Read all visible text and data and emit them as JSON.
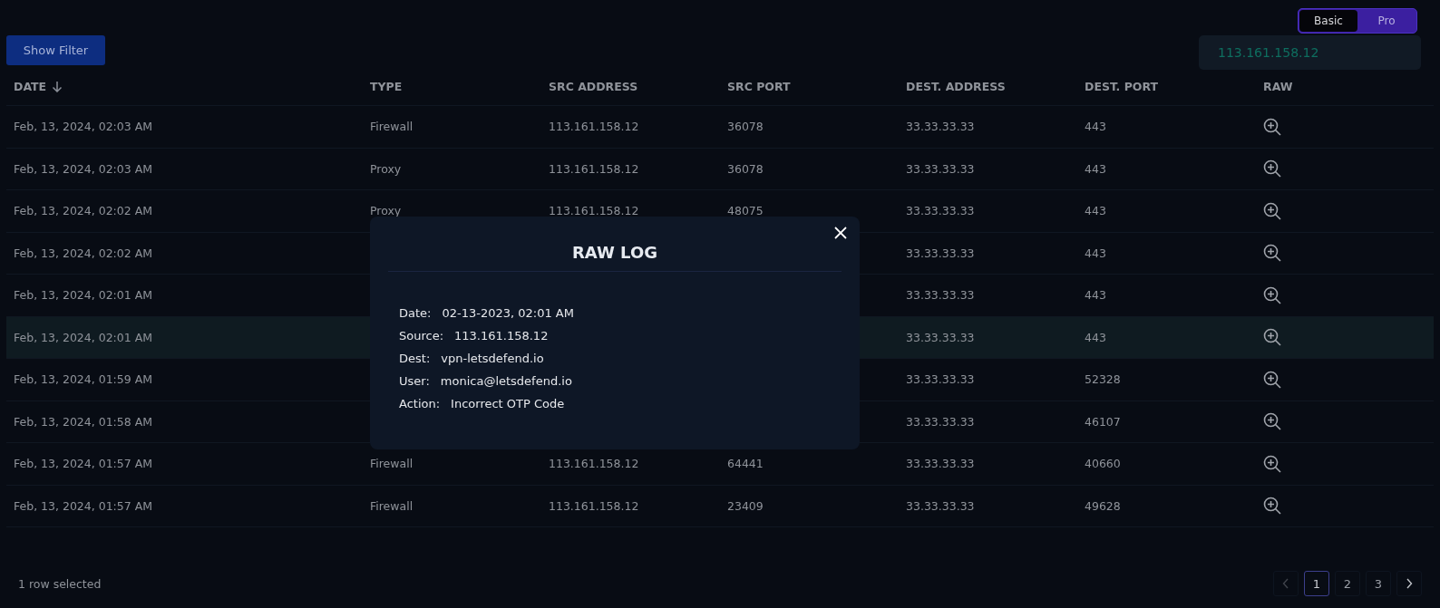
{
  "view_toggle": [
    {
      "label": "Basic",
      "selected": true
    },
    {
      "label": "Pro",
      "selected": false
    }
  ],
  "filter_button": "Show Filter",
  "search": {
    "value": "113.161.158.12"
  },
  "table": {
    "columns": [
      {
        "label": "DATE",
        "sorted_descending": true
      },
      {
        "label": "TYPE"
      },
      {
        "label": "SRC ADDRESS"
      },
      {
        "label": "SRC PORT"
      },
      {
        "label": "DEST. ADDRESS"
      },
      {
        "label": "DEST. PORT"
      },
      {
        "label": "RAW"
      }
    ],
    "rows": [
      {
        "date": "Feb, 13, 2024, 02:03 AM",
        "type": "Firewall",
        "src_address": "113.161.158.12",
        "src_port": "36078",
        "dest_address": "33.33.33.33",
        "dest_port": "443",
        "selected": false
      },
      {
        "date": "Feb, 13, 2024, 02:03 AM",
        "type": "Proxy",
        "src_address": "113.161.158.12",
        "src_port": "36078",
        "dest_address": "33.33.33.33",
        "dest_port": "443",
        "selected": false
      },
      {
        "date": "Feb, 13, 2024, 02:02 AM",
        "type": "Proxy",
        "src_address": "113.161.158.12",
        "src_port": "48075",
        "dest_address": "33.33.33.33",
        "dest_port": "443",
        "selected": false
      },
      {
        "date": "Feb, 13, 2024, 02:02 AM",
        "dest_address": "33.33.33.33",
        "dest_port": "443",
        "selected": false
      },
      {
        "date": "Feb, 13, 2024, 02:01 AM",
        "dest_address": "33.33.33.33",
        "dest_port": "443",
        "selected": false
      },
      {
        "date": "Feb, 13, 2024, 02:01 AM",
        "dest_address": "33.33.33.33",
        "dest_port": "443",
        "selected": true
      },
      {
        "date": "Feb, 13, 2024, 01:59 AM",
        "dest_address": "33.33.33.33",
        "dest_port": "52328",
        "selected": false
      },
      {
        "date": "Feb, 13, 2024, 01:58 AM",
        "dest_address": "33.33.33.33",
        "dest_port": "46107",
        "selected": false
      },
      {
        "date": "Feb, 13, 2024, 01:57 AM",
        "type": "Firewall",
        "src_address": "113.161.158.12",
        "src_port": "64441",
        "dest_address": "33.33.33.33",
        "dest_port": "40660",
        "selected": false
      },
      {
        "date": "Feb, 13, 2024, 01:57 AM",
        "type": "Firewall",
        "src_address": "113.161.158.12",
        "src_port": "23409",
        "dest_address": "33.33.33.33",
        "dest_port": "49628",
        "selected": false
      }
    ]
  },
  "footer": {
    "selection_count": "1 row selected"
  },
  "pagination": {
    "pages": [
      {
        "label": "1",
        "selected": true
      },
      {
        "label": "2",
        "selected": false
      },
      {
        "label": "3",
        "selected": false
      }
    ],
    "prev_disabled": true,
    "next_disabled": false
  },
  "modal": {
    "title": "RAW LOG",
    "fields": [
      {
        "label": "Date:",
        "value": "02-13-2023, 02:01 AM"
      },
      {
        "label": "Source:",
        "value": "113.161.158.12"
      },
      {
        "label": "Dest:",
        "value": "vpn-letsdefend.io"
      },
      {
        "label": "User:",
        "value": "monica@letsdefend.io"
      },
      {
        "label": "Action:",
        "value": "Incorrect OTP Code"
      }
    ]
  }
}
